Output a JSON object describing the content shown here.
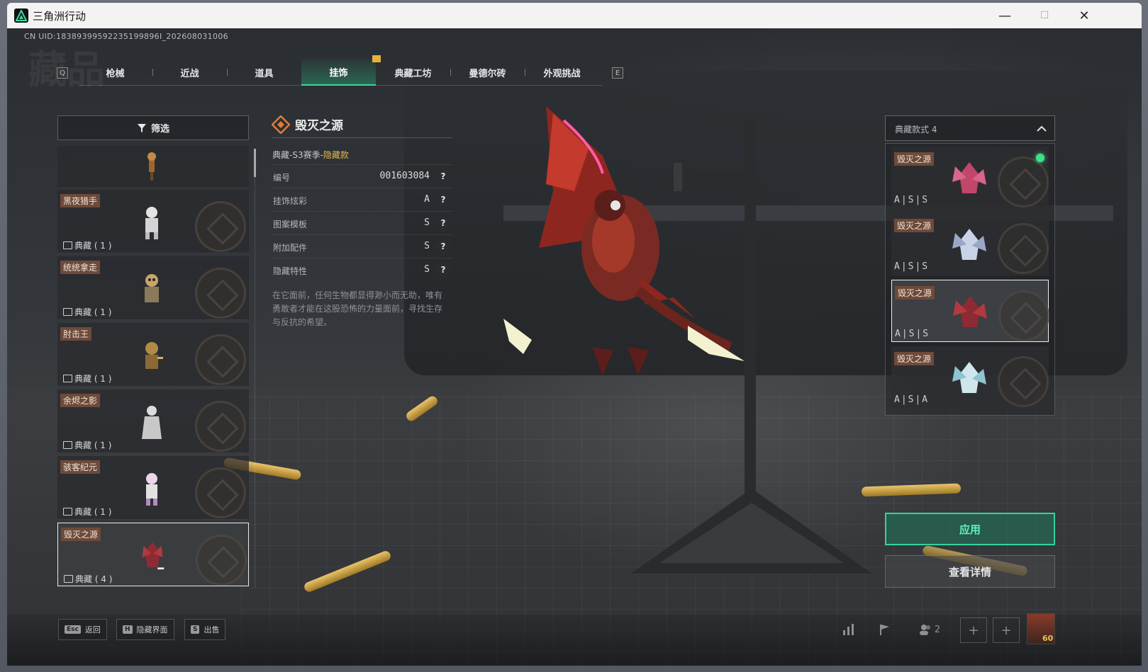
{
  "window": {
    "title": "三角洲行动",
    "minimize": "—",
    "maximize": "☐",
    "close": "✕"
  },
  "uid_text": "CN UID:18389399592235199896I_202608031006",
  "bg_heading": "藏品",
  "tabs": {
    "left_key": "Q",
    "right_key": "E",
    "items": [
      "枪械",
      "近战",
      "道具",
      "挂饰",
      "典藏工坊",
      "曼德尔砖",
      "外观挑战"
    ],
    "active_index": 3
  },
  "filter": {
    "label": "筛选"
  },
  "items": [
    {
      "name": "",
      "count": ""
    },
    {
      "name": "黑夜猎手",
      "count": "典藏 ( 1 )"
    },
    {
      "name": "统统拿走",
      "count": "典藏 ( 1 )"
    },
    {
      "name": "肘击王",
      "count": "典藏 ( 1 )"
    },
    {
      "name": "余烬之影",
      "count": "典藏 ( 1 )"
    },
    {
      "name": "骇客纪元",
      "count": "典藏 ( 1 )"
    },
    {
      "name": "毁灭之源",
      "count": "典藏 ( 4 )"
    }
  ],
  "selected_item_index": 6,
  "detail": {
    "title": "毁灭之源",
    "subtitle_prefix": "典藏-S3赛季-",
    "subtitle_highlight": "隐藏款",
    "attributes": [
      {
        "label": "编号",
        "value": "001603084"
      },
      {
        "label": "挂饰炫彩",
        "value": "A"
      },
      {
        "label": "图案模板",
        "value": "S"
      },
      {
        "label": "附加配件",
        "value": "S"
      },
      {
        "label": "隐藏特性",
        "value": "S"
      }
    ],
    "help_glyph": "?",
    "description": "在它面前，任何生物都显得渺小而无助，唯有勇敢者才能在这股恐怖的力量面前，寻找生存与反抗的希望。"
  },
  "variants": {
    "header": "典藏款式 4",
    "items": [
      {
        "name": "毁灭之源",
        "grade": "A|S|S",
        "color": "#c2456a",
        "equipped": true
      },
      {
        "name": "毁灭之源",
        "grade": "A|S|S",
        "color": "#c9d3e8",
        "equipped": false
      },
      {
        "name": "毁灭之源",
        "grade": "A|S|S",
        "color": "#8e2a33",
        "equipped": false
      },
      {
        "name": "毁灭之源",
        "grade": "A|S|A",
        "color": "#cfe6ec",
        "equipped": false
      }
    ],
    "selected_index": 2
  },
  "actions": {
    "apply": "应用",
    "details": "查看详情"
  },
  "bottom": {
    "hints": [
      {
        "key": "Esc",
        "label": "返回"
      },
      {
        "key": "H",
        "label": "隐藏界面"
      },
      {
        "key": "S",
        "label": "出售"
      }
    ],
    "team_count": "2",
    "avatar_level": "60"
  },
  "colors": {
    "accent": "#33d39a",
    "tag_bg": "#6d4a3a",
    "highlight": "#e4b94a",
    "equipped": "#3ee08a"
  }
}
